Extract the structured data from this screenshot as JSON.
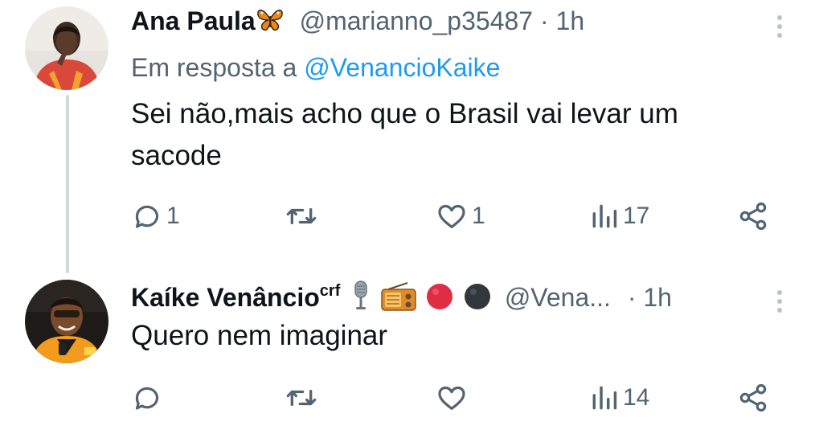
{
  "tweets": [
    {
      "name": "Ana Paula",
      "name_emoji": "butterfly",
      "handle": "@marianno_p35487",
      "separator": "·",
      "time": "1h",
      "reply_prefix": "Em resposta a",
      "reply_handle": "@VenancioKaike",
      "text_line1": "Sei não,mais acho que o Brasil vai levar um",
      "text_line2": "sacode",
      "replies": "1",
      "retweets": "",
      "likes": "1",
      "views": "17"
    },
    {
      "name": "Kaíke Venâncio",
      "name_superscript": "crf",
      "name_emojis": [
        "microphone",
        "radio",
        "red-circle",
        "black-circle"
      ],
      "handle": "@Vena...",
      "separator": "·",
      "time": "1h",
      "text_line1": "Quero nem imaginar",
      "replies": "",
      "retweets": "",
      "likes": "",
      "views": "14"
    }
  ],
  "icons": {
    "reply": "reply-icon",
    "retweet": "retweet-icon",
    "like": "heart-icon",
    "views": "views-icon",
    "share": "share-icon",
    "more": "more-icon"
  },
  "colors": {
    "text": "#0f1419",
    "secondary": "#536471",
    "link": "#1d9bf0",
    "thread_line": "#cfd9de"
  }
}
